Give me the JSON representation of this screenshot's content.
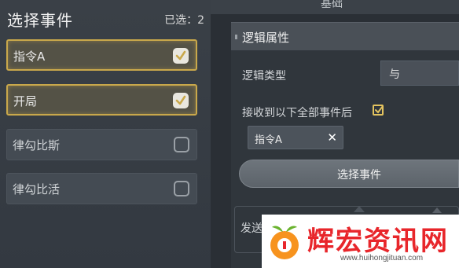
{
  "left_panel": {
    "title": "选择事件",
    "selected_count": "已选：2",
    "items": [
      {
        "label": "指令A",
        "checked": true
      },
      {
        "label": "开局",
        "checked": true
      },
      {
        "label": "律勾比斯",
        "checked": false
      },
      {
        "label": "律勾比活",
        "checked": false
      }
    ]
  },
  "right_panel": {
    "top_tab": "基础",
    "section_title": "逻辑属性",
    "logic_type_label": "逻辑类型",
    "logic_type_value": "与",
    "trigger_label": "接收到以下全部事件后",
    "trigger_checked": true,
    "tag_label": "指令A",
    "tag_close_icon": "close-icon",
    "select_event_button": "选择事件",
    "bottom_label": "发送"
  },
  "watermark": {
    "brand": "辉宏资讯网",
    "url": "www.huihongjituan.com"
  },
  "colors": {
    "accent_gold": "#c9a84b",
    "watermark_red": "#e8262b"
  }
}
